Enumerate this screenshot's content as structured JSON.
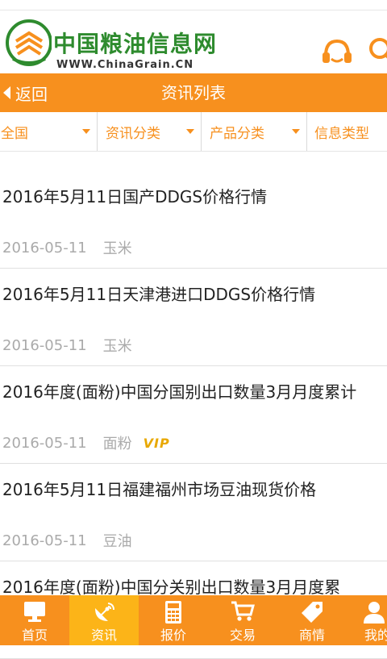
{
  "header": {
    "logo_title": "中国粮油信息网",
    "logo_url": "WWW.ChinaGrain.CN",
    "icons": [
      "customer-service-icon",
      "search-icon"
    ]
  },
  "titlebar": {
    "back_label": "返回",
    "title": "资讯列表"
  },
  "filters": [
    {
      "label": "全国"
    },
    {
      "label": "资讯分类"
    },
    {
      "label": "产品分类"
    },
    {
      "label": "信息类型"
    }
  ],
  "articles": [
    {
      "title": "2016年5月11日国产DDGS价格行情",
      "date": "2016-05-11",
      "category": "玉米"
    },
    {
      "title": "2016年5月11日天津港进口DDGS价格行情",
      "date": "2016-05-11",
      "category": "玉米"
    },
    {
      "title": "2016年度(面粉)中国分国别出口数量3月月度累计",
      "date": "2016-05-11",
      "category": "面粉",
      "badge": "VIP"
    },
    {
      "title": "2016年5月11日福建福州市场豆油现货价格",
      "date": "2016-05-11",
      "category": "豆油"
    },
    {
      "title": "2016年度(面粉)中国分关别出口数量3月月度累",
      "date": "",
      "category": ""
    }
  ],
  "tabs": [
    {
      "label": "首页",
      "icon": "monitor-icon"
    },
    {
      "label": "资讯",
      "icon": "satellite-dish-icon",
      "active": true
    },
    {
      "label": "报价",
      "icon": "calculator-icon"
    },
    {
      "label": "交易",
      "icon": "cart-icon"
    },
    {
      "label": "商情",
      "icon": "tag-icon"
    },
    {
      "label": "我的",
      "icon": "user-icon"
    }
  ],
  "colors": {
    "accent": "#f7901e",
    "active_tab": "#fcb418",
    "logo_green": "#2e8b2e"
  }
}
